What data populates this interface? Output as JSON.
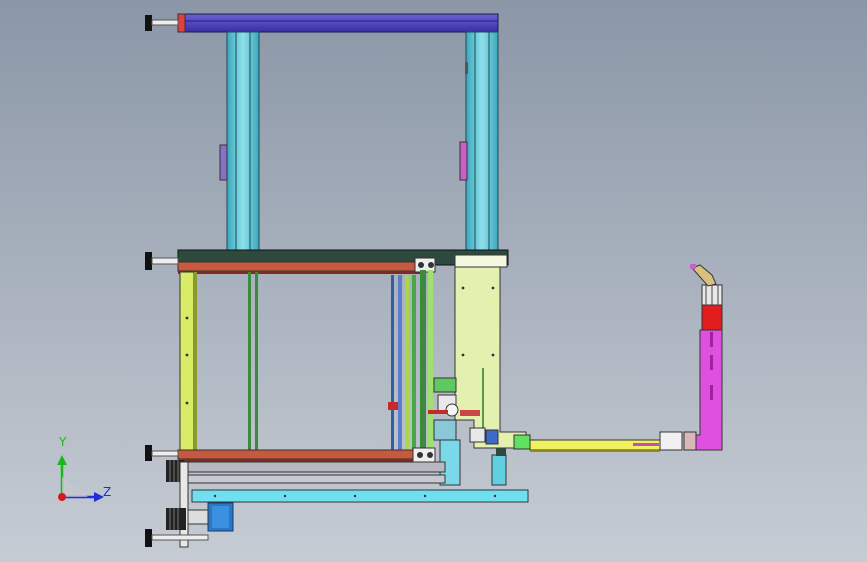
{
  "viewport": {
    "background_top": "#8b97a7",
    "background_bottom": "#c6ccd4"
  },
  "triad": {
    "y_label": "Y",
    "z_label": "Z",
    "y_color": "#18b818",
    "z_color": "#1c2fd8",
    "x_color": "#d81818"
  },
  "colors": {
    "top_rail": "#5a4fc8",
    "column": "#62c8d8",
    "frame_dark": "#2e4a3e",
    "red_bar": "#c8583e",
    "lime": "#d8ec68",
    "plate": "#e4f0b0",
    "yellow_arm": "#f0f060",
    "magenta": "#e050e0",
    "red_block": "#e01c1c",
    "motor_blue": "#2878c8",
    "base_cyan": "#70e0f0"
  }
}
